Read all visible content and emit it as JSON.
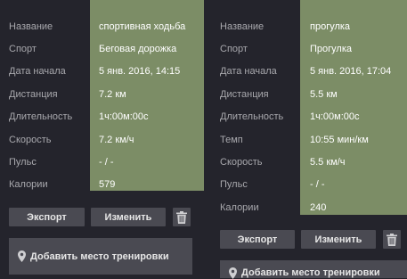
{
  "left": {
    "rows": [
      {
        "label": "Название",
        "value": "спортивная ходьба"
      },
      {
        "label": "Спорт",
        "value": "Беговая дорожка"
      },
      {
        "label": "Дата начала",
        "value": "5 янв. 2016, 14:15"
      },
      {
        "label": "Дистанция",
        "value": "7.2 км"
      },
      {
        "label": "Длительность",
        "value": "1ч:00м:00с"
      },
      {
        "label": "Скорость",
        "value": "7.2 км/ч"
      },
      {
        "label": "Пульс",
        "value": "- / -"
      },
      {
        "label": "Калории",
        "value": "579"
      }
    ],
    "export_label": "Экспорт",
    "edit_label": "Изменить",
    "add_place_label": "Добавить место тренировки"
  },
  "right": {
    "rows": [
      {
        "label": "Название",
        "value": "прогулка"
      },
      {
        "label": "Спорт",
        "value": "Прогулка"
      },
      {
        "label": "Дата начала",
        "value": "5 янв. 2016, 17:04"
      },
      {
        "label": "Дистанция",
        "value": "5.5 км"
      },
      {
        "label": "Длительность",
        "value": "1ч:00м:00с"
      },
      {
        "label": "Темп",
        "value": "10:55 мин/км"
      },
      {
        "label": "Скорость",
        "value": "5.5 км/ч"
      },
      {
        "label": "Пульс",
        "value": "- / -"
      },
      {
        "label": "Калории",
        "value": "240"
      }
    ],
    "export_label": "Экспорт",
    "edit_label": "Изменить",
    "add_place_label": "Добавить место тренировки"
  },
  "icons": {
    "trash": "trash-icon",
    "pin": "map-pin-icon"
  },
  "colors": {
    "background": "#24242c",
    "value_column": "#7c8d66",
    "button": "#4a4a52"
  }
}
